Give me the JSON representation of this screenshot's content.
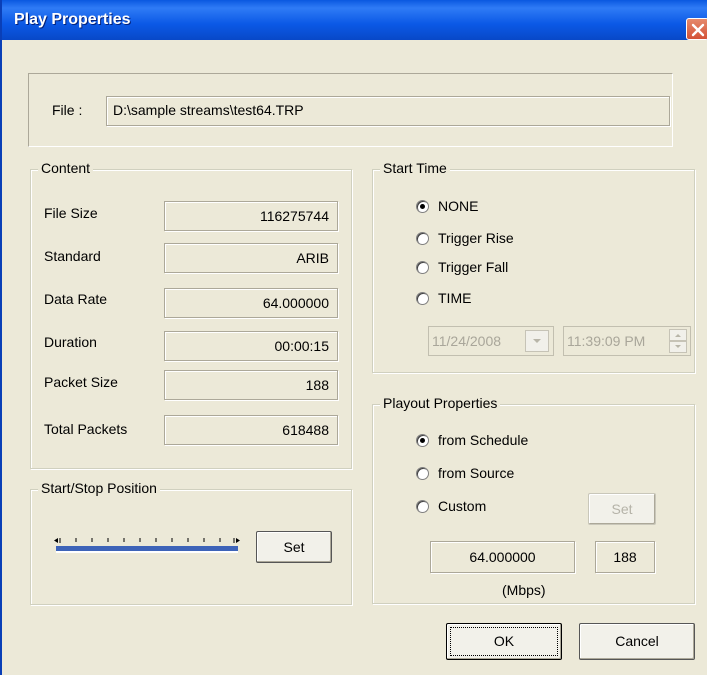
{
  "window": {
    "title": "Play Properties"
  },
  "file": {
    "label": "File :",
    "value": "D:\\sample streams\\test64.TRP"
  },
  "content": {
    "legend": "Content",
    "rows": [
      {
        "label": "File Size",
        "value": "116275744"
      },
      {
        "label": "Standard",
        "value": "ARIB"
      },
      {
        "label": "Data Rate",
        "value": "64.000000"
      },
      {
        "label": "Duration",
        "value": "00:00:15"
      },
      {
        "label": "Packet Size",
        "value": "188"
      },
      {
        "label": "Total Packets",
        "value": "618488"
      }
    ]
  },
  "start_stop": {
    "legend": "Start/Stop Position",
    "set_label": "Set"
  },
  "start_time": {
    "legend": "Start Time",
    "options": [
      {
        "label": "NONE",
        "selected": true
      },
      {
        "label": "Trigger Rise",
        "selected": false
      },
      {
        "label": "Trigger Fall",
        "selected": false
      },
      {
        "label": "TIME",
        "selected": false
      }
    ],
    "date": "11/24/2008",
    "time": "11:39:09 PM"
  },
  "playout": {
    "legend": "Playout Properties",
    "options": [
      {
        "label": "from Schedule",
        "selected": true
      },
      {
        "label": "from Source",
        "selected": false
      },
      {
        "label": "Custom",
        "selected": false
      }
    ],
    "set_label": "Set",
    "rate": "64.000000",
    "packet": "188",
    "unit": "(Mbps)"
  },
  "buttons": {
    "ok": "OK",
    "cancel": "Cancel"
  },
  "colors": {
    "title_bar": "#0a58e0",
    "dialog_bg": "#ece9d8",
    "slider_track": "#3d63b8"
  }
}
